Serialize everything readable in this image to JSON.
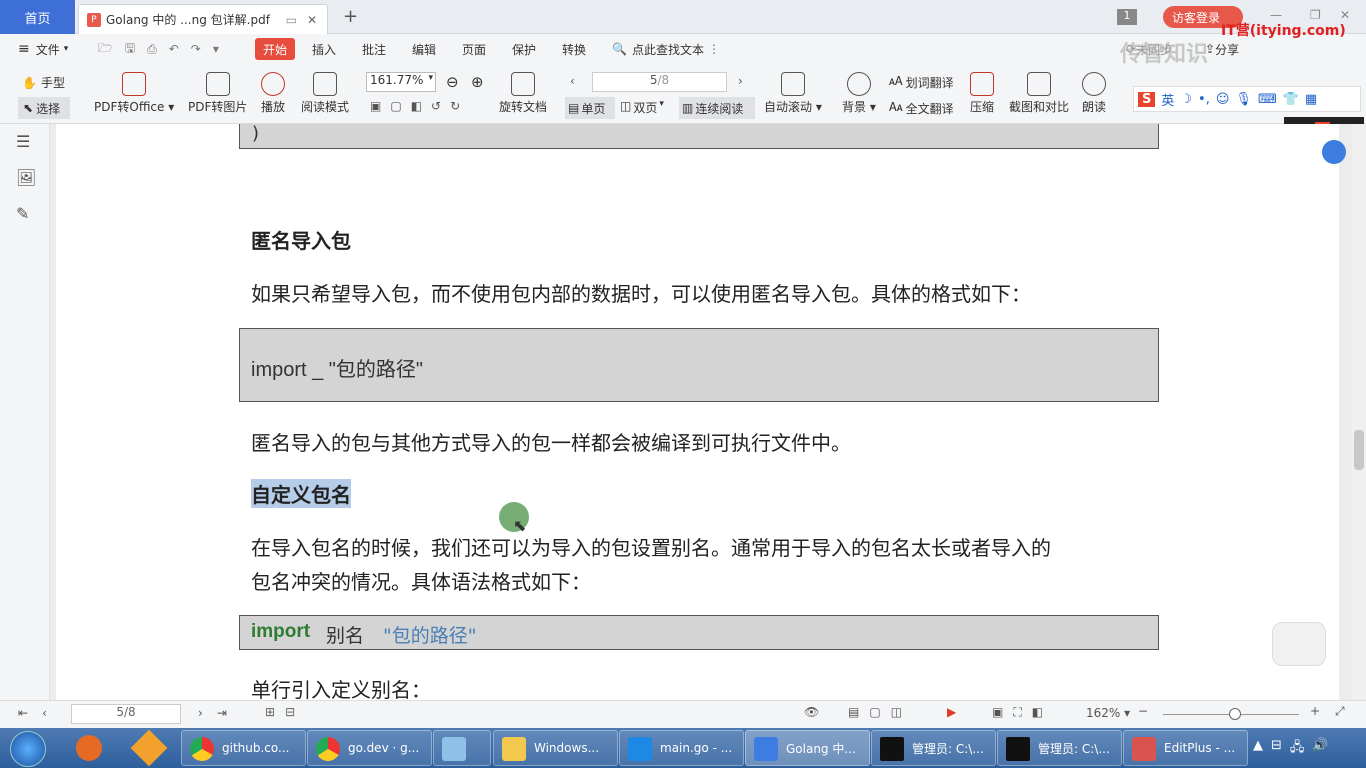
{
  "tabs": {
    "home": "首页",
    "doc": "Golang 中的 ...ng 包详解.pdf",
    "badge": "1",
    "login": "访客登录"
  },
  "watermark": {
    "site": "IT营(itying.com)",
    "brand": "传智知识"
  },
  "menu": {
    "file": "文件",
    "start": "开始",
    "insert": "插入",
    "comment": "批注",
    "edit": "编辑",
    "page": "页面",
    "protect": "保护",
    "convert": "转换",
    "search": "点此查找文本",
    "sync": "未同步",
    "share": "分享"
  },
  "toolbar": {
    "hand": "手型",
    "select": "选择",
    "pdf_office": "PDF转Office",
    "pdf_image": "PDF转图片",
    "play": "播放",
    "read_mode": "阅读模式",
    "zoom": "161.77%",
    "rotate": "旋转文档",
    "page_current": "5",
    "page_total": "/8",
    "single": "单页",
    "double": "双页",
    "continuous": "连续阅读",
    "autoscroll": "自动滚动",
    "background": "背景",
    "word_translate": "划词翻译",
    "full_translate": "全文翻译",
    "compress": "压缩",
    "screenshot": "截图和对比",
    "read_aloud": "朗读"
  },
  "doc": {
    "close_paren": ")",
    "heading1": "匿名导入包",
    "para1": "如果只希望导入包，而不使用包内部的数据时，可以使用匿名导入包。具体的格式如下：",
    "code1": "import _ \"包的路径\"",
    "para2": "匿名导入的包与其他方式导入的包一样都会被编译到可执行文件中。",
    "heading2": "自定义包名",
    "para3a": "在导入包名的时候，我们还可以为导入的包设置别名。通常用于导入的包名太长或者导入的",
    "para3b": "包名冲突的情况。具体语法格式如下：",
    "code2_kw": "import",
    "code2_alias": "别名",
    "code2_str": "\"包的路径\"",
    "para4": "单行引入定义别名："
  },
  "status": {
    "page": "5/8",
    "zoom": "162%"
  },
  "taskbar": [
    "github.co...",
    "go.dev · g...",
    "Windows...",
    "main.go - ...",
    "Golang 中...",
    "管理员: C:\\...",
    "管理员: C:\\...",
    "EditPlus - ..."
  ],
  "colors": {
    "accent": "#3d6fd6",
    "start_btn": "#e74c3c",
    "code_kw": "#2e7d32",
    "code_str": "#4a7fb5"
  }
}
